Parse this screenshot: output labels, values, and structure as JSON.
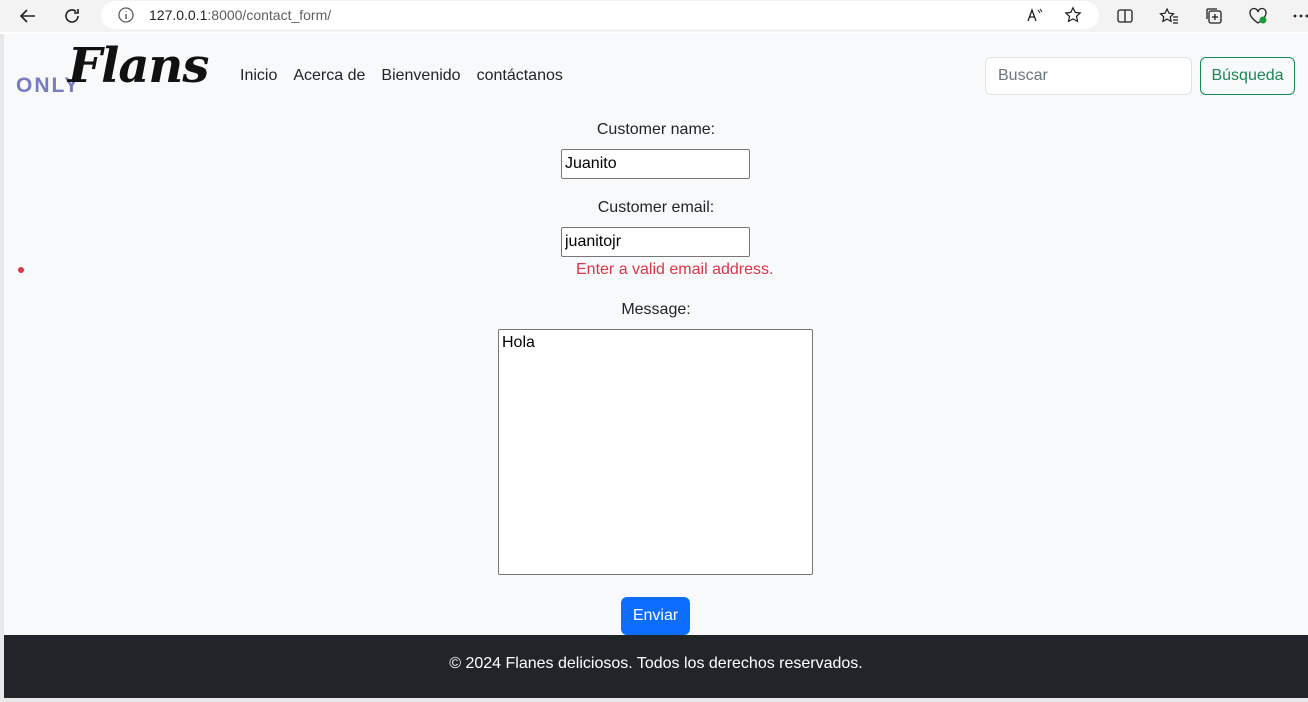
{
  "browser": {
    "url_host": "127.0.0.1",
    "url_rest": ":8000/contact_form/"
  },
  "brand": {
    "only": "ONLY",
    "flans": "Flans"
  },
  "nav": {
    "links": [
      "Inicio",
      "Acerca de",
      "Bienvenido",
      "contáctanos"
    ]
  },
  "search": {
    "placeholder": "Buscar",
    "button_label": "Búsqueda"
  },
  "form": {
    "name_label": "Customer name:",
    "name_value": "Juanito",
    "email_label": "Customer email:",
    "email_value": "juanitojr",
    "email_error": "Enter a valid email address.",
    "message_label": "Message:",
    "message_value": "Hola",
    "submit_label": "Enviar"
  },
  "footer": {
    "text": "© 2024 Flanes deliciosos. Todos los derechos reservados."
  },
  "colors": {
    "primary": "#0d6efd",
    "success": "#198754",
    "danger": "#dc3545",
    "footer_bg": "#212529"
  }
}
